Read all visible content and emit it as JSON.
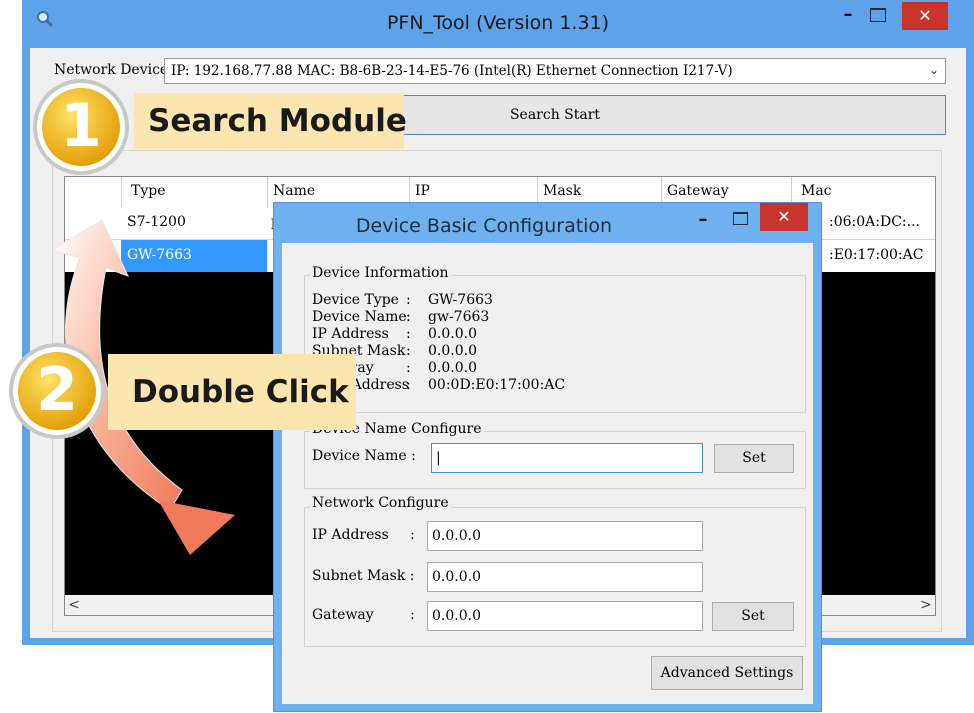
{
  "main_window": {
    "title": "PFN_Tool (Version 1.31)",
    "min_glyph": "–",
    "close_glyph": "✕",
    "network_devices_label": "Network Devices :",
    "network_device_value": "IP: 192.168.77.88  MAC: B8-6B-23-14-E5-76 (Intel(R) Ethernet Connection I217-V)",
    "dropdown_glyph": "⌄",
    "search_button": "Search Start",
    "table": {
      "columns": [
        "Type",
        "Name",
        "IP",
        "Mask",
        "Gateway",
        "Mac"
      ],
      "rows": [
        {
          "type": "S7-1200",
          "name_partial": "p",
          "mac_partial": ":06:0A:DC:..."
        },
        {
          "type": "GW-7663",
          "mac_partial": ":E0:17:00:AC",
          "selected": true
        }
      ]
    },
    "scroll_left": "<",
    "scroll_right": ">"
  },
  "dialog": {
    "title": "Device Basic Configuration",
    "min_glyph": "–",
    "close_glyph": "✕",
    "device_information": {
      "title": "Device Information",
      "lines": [
        {
          "label": "Device Type",
          "sep": ":",
          "value": "GW-7663"
        },
        {
          "label": "Device Name",
          "sep": ":",
          "value": "gw-7663"
        },
        {
          "label": "IP Address",
          "sep": ":",
          "value": "0.0.0.0"
        },
        {
          "label": "Subnet Mask",
          "sep": ":",
          "value": "0.0.0.0"
        },
        {
          "label": "Gateway",
          "sep": ":",
          "value": "0.0.0.0"
        },
        {
          "label": "MAC Address",
          "sep": ":",
          "value": "00:0D:E0:17:00:AC"
        }
      ]
    },
    "device_name_configure": {
      "title": "Device Name Configure",
      "label": "Device Name  :",
      "value": "|",
      "set_button": "Set"
    },
    "network_configure": {
      "title": "Network Configure",
      "ip_label": "IP Address",
      "ip_value": "0.0.0.0",
      "mask_label": "Subnet Mask :",
      "mask_value": "0.0.0.0",
      "gateway_label": "Gateway",
      "gateway_value": "0.0.0.0",
      "colon": ":",
      "set_button": "Set"
    },
    "advanced_button": "Advanced Settings"
  },
  "callouts": {
    "step1": {
      "number": "1",
      "text": "Search Module"
    },
    "step2": {
      "number": "2",
      "text": "Double Click"
    }
  },
  "colors": {
    "title_bar": "#5ea2ea",
    "close_button": "#c7342e",
    "selection": "#3399ff",
    "callout_fill": "#fbe6b0",
    "badge_gold": "#f5b400"
  }
}
